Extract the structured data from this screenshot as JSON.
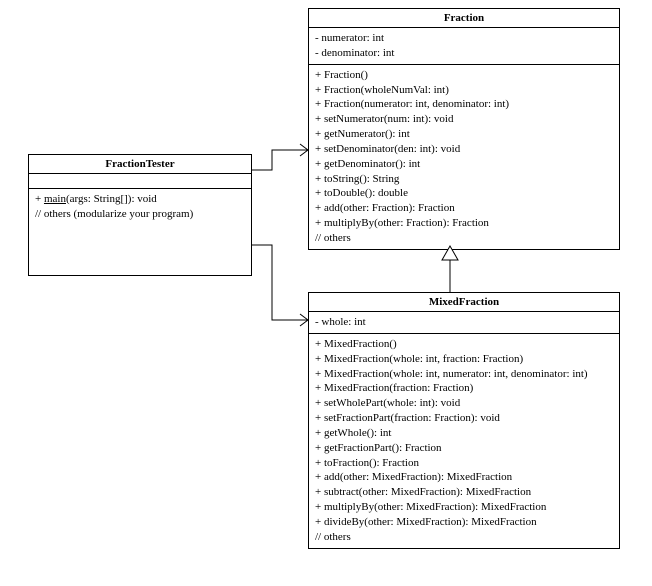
{
  "chart_data": {
    "type": "diagram",
    "title": "",
    "diagram_kind": "UML class diagram",
    "classes": [
      {
        "id": "tester",
        "name": "FractionTester",
        "attributes": [],
        "methods": [
          "+ main(args: String[]): void",
          "// others (modularize your program)"
        ]
      },
      {
        "id": "fraction",
        "name": "Fraction",
        "attributes": [
          "- numerator: int",
          "- denominator: int"
        ],
        "methods": [
          "+ Fraction()",
          "+ Fraction(wholeNumVal: int)",
          "+ Fraction(numerator: int, denominator: int)",
          "+ setNumerator(num: int): void",
          "+ getNumerator(): int",
          "+ setDenominator(den: int): void",
          "+ getDenominator(): int",
          "+ toString(): String",
          "+ toDouble(): double",
          "+ add(other: Fraction): Fraction",
          "+ multiplyBy(other: Fraction): Fraction",
          "// others"
        ]
      },
      {
        "id": "mixed",
        "name": "MixedFraction",
        "attributes": [
          "- whole: int"
        ],
        "methods": [
          "+ MixedFraction()",
          "+ MixedFraction(whole: int, fraction: Fraction)",
          "+ MixedFraction(whole: int, numerator: int, denominator: int)",
          "+ MixedFraction(fraction: Fraction)",
          "+ setWholePart(whole: int): void",
          "+ setFractionPart(fraction: Fraction): void",
          "+ getWhole(): int",
          "+ getFractionPart(): Fraction",
          "+ toFraction(): Fraction",
          "+ add(other: MixedFraction): MixedFraction",
          "+ subtract(other: MixedFraction): MixedFraction",
          "+ multiplyBy(other: MixedFraction): MixedFraction",
          "+ divideBy(other: MixedFraction): MixedFraction",
          "// others"
        ]
      }
    ],
    "relationships": [
      {
        "from": "tester",
        "to": "fraction",
        "type": "association-arrow"
      },
      {
        "from": "tester",
        "to": "mixed",
        "type": "association-arrow"
      },
      {
        "from": "mixed",
        "to": "fraction",
        "type": "generalization"
      }
    ]
  }
}
